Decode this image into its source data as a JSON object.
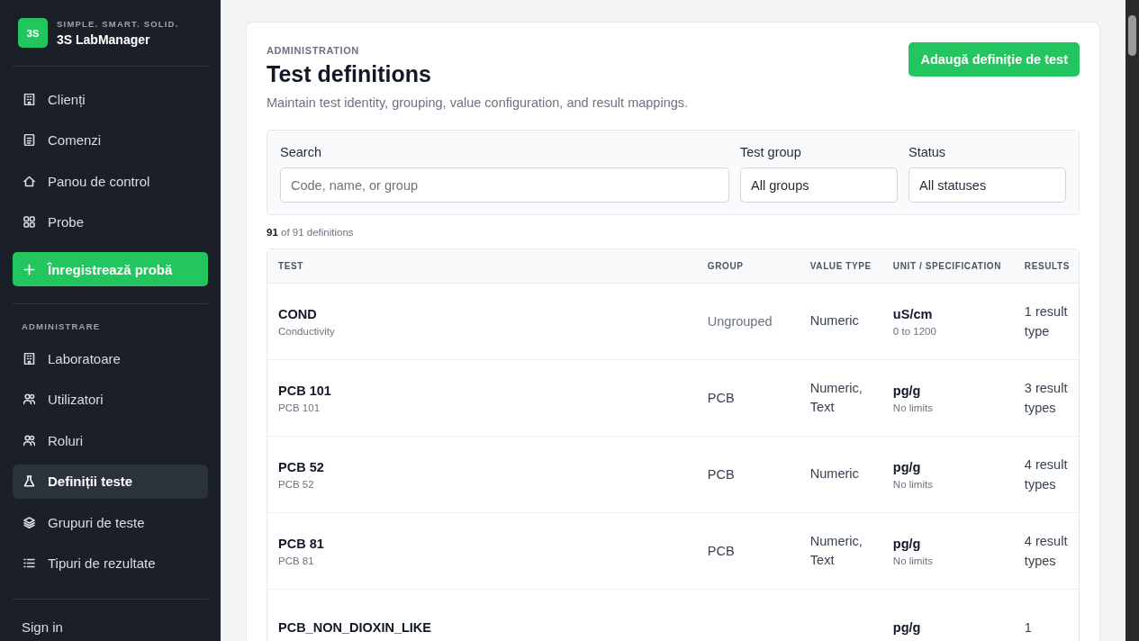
{
  "sidebar": {
    "brand": {
      "badge": "3S",
      "tagline": "SIMPLE. SMART. SOLID.",
      "name": "3S LabManager"
    },
    "nav_items": [
      {
        "label": "Clienți",
        "selected": false
      },
      {
        "label": "Comenzi",
        "selected": false
      },
      {
        "label": "Panou de control",
        "selected": false
      },
      {
        "label": "Probe",
        "selected": false
      }
    ],
    "primary_action": "Înregistrează probă",
    "admin_heading": "ADMINISTRARE",
    "admin_items": [
      {
        "label": "Laboratoare",
        "selected": false
      },
      {
        "label": "Utilizatori",
        "selected": false
      },
      {
        "label": "Roluri",
        "selected": false
      },
      {
        "label": "Definiții teste",
        "selected": true
      },
      {
        "label": "Grupuri de teste",
        "selected": false
      },
      {
        "label": "Tipuri de rezultate",
        "selected": false
      }
    ],
    "sign_in": "Sign in"
  },
  "page": {
    "eyebrow": "ADMINISTRATION",
    "title": "Test definitions",
    "subtitle": "Maintain test identity, grouping, value configuration, and result mappings.",
    "add_button": "Adaugă definiție de test"
  },
  "filters": [
    {
      "label": "Search",
      "kind": "text",
      "placeholder": "Code, name, or group"
    },
    {
      "label": "Test group",
      "kind": "select",
      "value": "All groups"
    },
    {
      "label": "Status",
      "kind": "select",
      "value": "All statuses"
    }
  ],
  "count": {
    "shown": "91",
    "rest": "of 91 definitions"
  },
  "table": {
    "columns": [
      "TEST",
      "GROUP",
      "VALUE TYPE",
      "UNIT / SPECIFICATION",
      "RESULTS"
    ],
    "rows": [
      {
        "code": "COND",
        "name": "Conductivity",
        "group": "Ungrouped",
        "grouped": false,
        "value_type": "Numeric",
        "unit": "uS/cm",
        "spec": "0 to 1200",
        "results": "1 result type"
      },
      {
        "code": "PCB 101",
        "name": "PCB 101",
        "group": "PCB",
        "grouped": true,
        "value_type": "Numeric, Text",
        "unit": "pg/g",
        "spec": "No limits",
        "results": "3 result types"
      },
      {
        "code": "PCB 52",
        "name": "PCB 52",
        "group": "PCB",
        "grouped": true,
        "value_type": "Numeric",
        "unit": "pg/g",
        "spec": "No limits",
        "results": "4 result types"
      },
      {
        "code": "PCB 81",
        "name": "PCB 81",
        "group": "PCB",
        "grouped": true,
        "value_type": "Numeric, Text",
        "unit": "pg/g",
        "spec": "No limits",
        "results": "4 result types"
      },
      {
        "code": "PCB_NON_DIOXIN_LIKE",
        "unit": "pg/g",
        "results": "1"
      }
    ]
  }
}
